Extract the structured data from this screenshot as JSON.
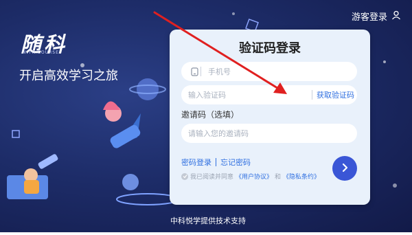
{
  "brand": {
    "logo": "随科",
    "sub": "WITH COURSE",
    "slogan": "开启高效学习之旅"
  },
  "header": {
    "guest_login": "游客登录",
    "user_icon": "user-icon"
  },
  "card": {
    "title": "验证码登录",
    "phone": {
      "placeholder": "手机号",
      "icon": "phone-icon"
    },
    "code": {
      "placeholder": "输入验证码",
      "get_code": "获取验证码"
    },
    "invite": {
      "label": "邀请码（选填）",
      "placeholder": "请输入您的邀请码"
    },
    "links": {
      "password_login": "密码登录",
      "forgot_password": "忘记密码"
    },
    "agreement": {
      "prefix": "我已阅读并同意",
      "user_agreement": "《用户协议》",
      "and": "和",
      "privacy": "《隐私条约》"
    }
  },
  "footer": {
    "text": "中科悦学提供技术支持"
  },
  "colors": {
    "accent": "#2f6fe0",
    "button": "#3a56d6",
    "annotation_arrow": "#e02020"
  }
}
